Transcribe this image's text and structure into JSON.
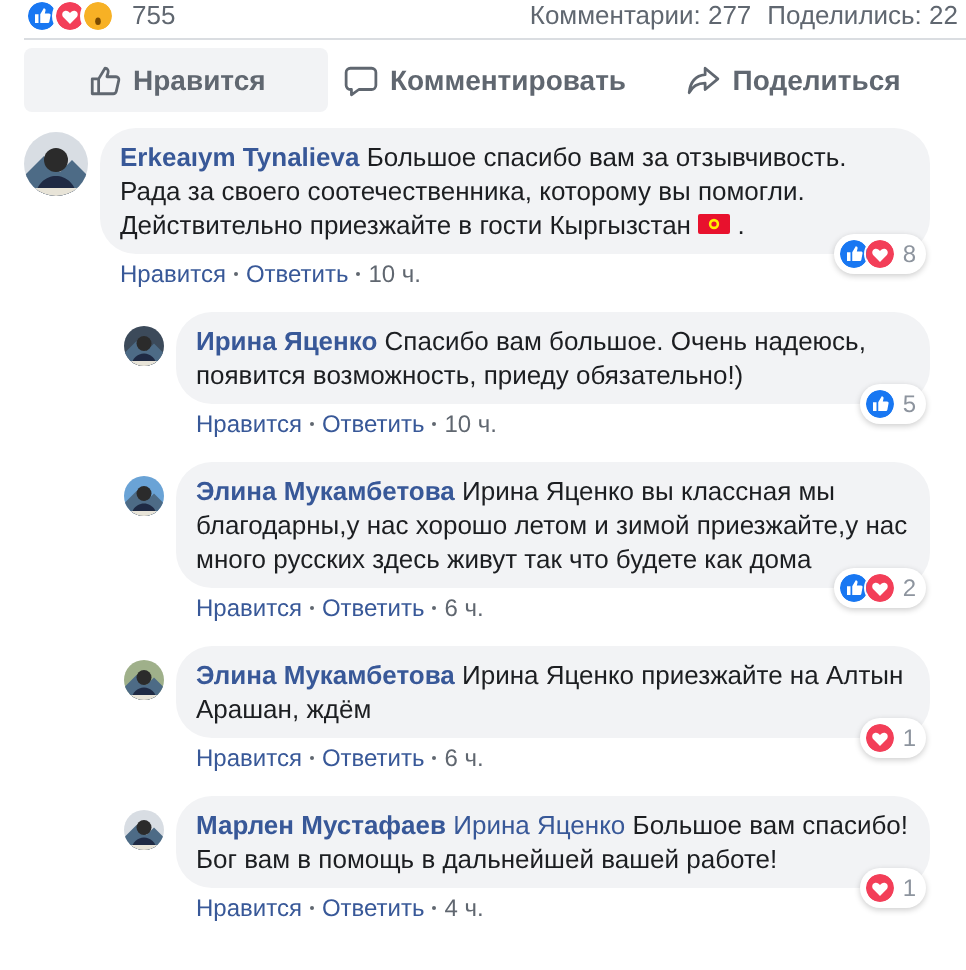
{
  "summary": {
    "reactions": [
      {
        "kind": "like"
      },
      {
        "kind": "love"
      },
      {
        "kind": "wow"
      }
    ],
    "reaction_count": "755",
    "comments": "Комментарии: 277",
    "shares": "Поделились: 22"
  },
  "actions": [
    {
      "kind": "like",
      "label": "Нравится",
      "selected": true
    },
    {
      "kind": "comment",
      "label": "Комментировать",
      "selected": false
    },
    {
      "kind": "share",
      "label": "Поделиться",
      "selected": false
    }
  ],
  "comments": [
    {
      "author": "Erkeaıym Tynalieva",
      "text": "Большое спасибо вам за отзывчивость. Рада за своего соотечественника, которому вы помогли. Действительно приезжайте в гости Кыргызстан",
      "flag": true,
      "text_after": ".",
      "like": "Нравится",
      "reply": "Ответить",
      "time": "10 ч.",
      "reactions": [
        {
          "kind": "like"
        },
        {
          "kind": "love"
        }
      ],
      "reaction_count": "8",
      "replies": [
        {
          "author": "Ирина Яценко",
          "text": "Спасибо вам большое. Очень надеюсь, появится возможность, приеду обязательно!)",
          "like": "Нравится",
          "reply": "Ответить",
          "time": "10 ч.",
          "reactions": [
            {
              "kind": "like"
            }
          ],
          "reaction_count": "5"
        },
        {
          "author": "Элина Мукамбетова",
          "text": "Ирина Яценко вы классная мы благодарны,у нас хорошо летом и зимой приезжайте,у нас много русских здесь живут так что будете как дома",
          "like": "Нравится",
          "reply": "Ответить",
          "time": "6 ч.",
          "reactions": [
            {
              "kind": "like"
            },
            {
              "kind": "love"
            }
          ],
          "reaction_count": "2"
        },
        {
          "author": "Элина Мукамбетова",
          "text": "Ирина Яценко приезжайте на Алтын Арашан, ждём",
          "like": "Нравится",
          "reply": "Ответить",
          "time": "6 ч.",
          "reactions": [
            {
              "kind": "love"
            }
          ],
          "reaction_count": "1"
        },
        {
          "author": "Марлен Мустафаев",
          "mention": "Ирина Яценко",
          "text": "Большое вам спасибо! Бог вам в помощь в дальнейшей вашей работе!",
          "like": "Нравится",
          "reply": "Ответить",
          "time": "4 ч.",
          "reactions": [
            {
              "kind": "love"
            }
          ],
          "reaction_count": "1"
        }
      ]
    }
  ]
}
